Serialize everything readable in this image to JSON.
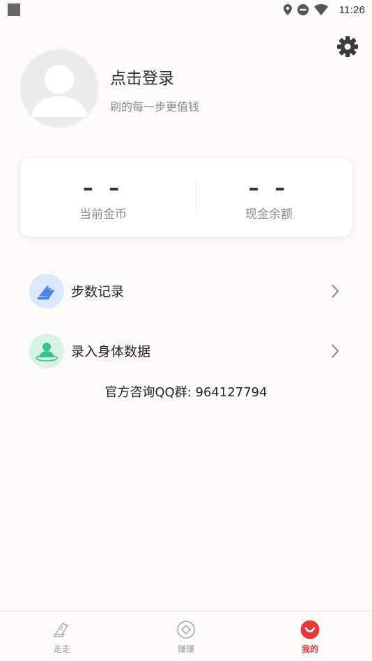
{
  "status_bar": {
    "time": "11:26",
    "icons": [
      "location-icon",
      "do-not-disturb-icon",
      "wifi-icon",
      "battery-icon"
    ]
  },
  "header": {
    "settings_icon": "gear-icon"
  },
  "profile": {
    "avatar_icon": "default-avatar-icon",
    "login_title": "点击登录",
    "subtitle": "刷的每一步更值钱"
  },
  "stats": {
    "coins": {
      "value": "– –",
      "label": "当前金币"
    },
    "cash": {
      "value": "– –",
      "label": "现金余额"
    }
  },
  "menu": [
    {
      "label": "步数记录",
      "icon": "shoe-icon",
      "icon_bg": "#dce8fb",
      "icon_color": "#4a86e8"
    },
    {
      "label": "录入身体数据",
      "icon": "person-icon",
      "icon_bg": "#d8f3e6",
      "icon_color": "#33c486"
    }
  ],
  "qq_group": "官方咨询QQ群: 964127794",
  "bottom_nav": {
    "items": [
      {
        "label": "走走",
        "icon": "shoe-icon",
        "active": false
      },
      {
        "label": "赚赚",
        "icon": "coin-icon",
        "active": false
      },
      {
        "label": "我的",
        "icon": "smile-icon",
        "active": true
      }
    ],
    "active_color": "#e8393a",
    "inactive_color": "#999999"
  }
}
